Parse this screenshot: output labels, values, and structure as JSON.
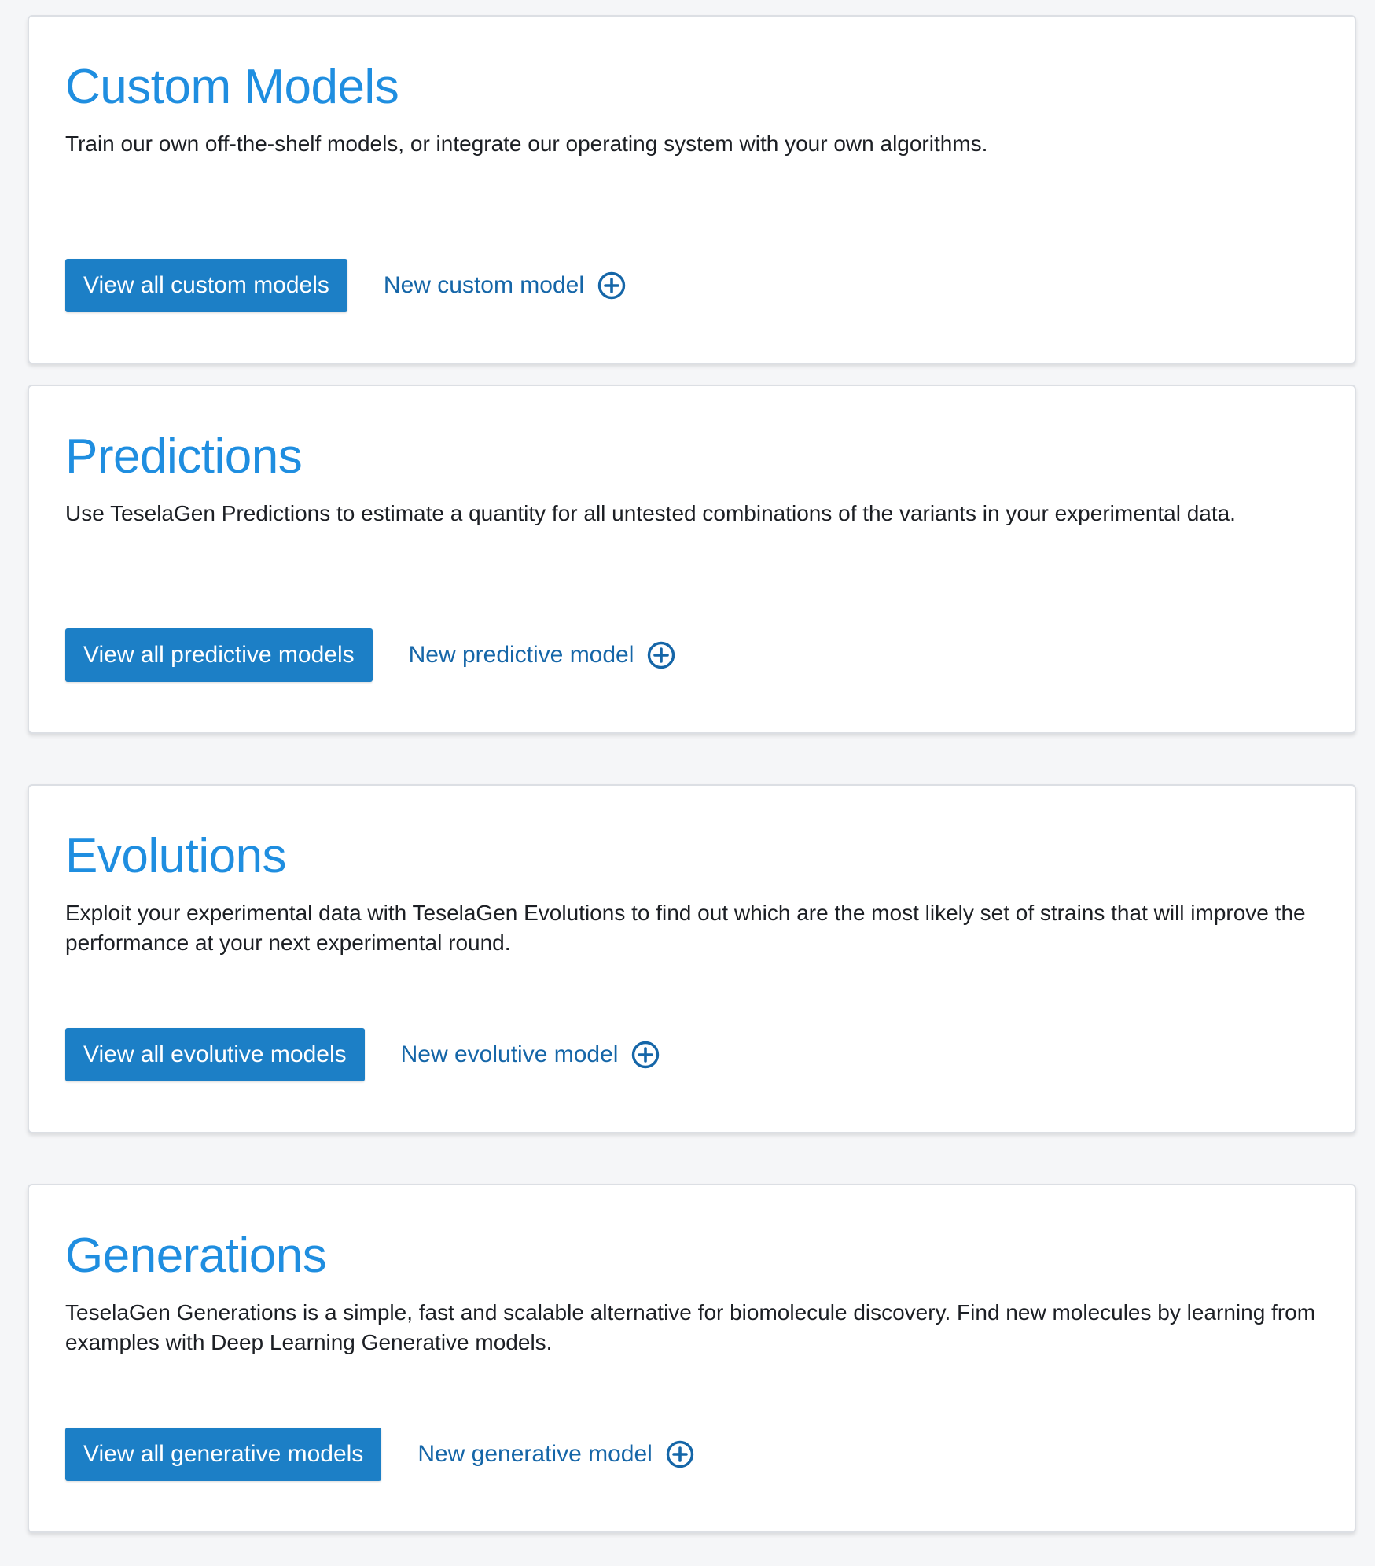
{
  "colors": {
    "title": "#1f8ee0",
    "primary_button": "#1c7fc6",
    "link": "#1566a8",
    "text": "#1c1f24",
    "background": "#f5f6f8"
  },
  "cards": [
    {
      "title": "Custom Models",
      "description": "Train our own off-the-shelf models, or integrate our operating system with your own algorithms.",
      "view_button": "View all custom models",
      "new_link": "New custom model",
      "new_icon": "plus-circle-icon"
    },
    {
      "title": "Predictions",
      "description": "Use TeselaGen Predictions to estimate a quantity for all untested combinations of the variants in your experimental data.",
      "view_button": "View all predictive models",
      "new_link": "New predictive model",
      "new_icon": "plus-circle-icon"
    },
    {
      "title": "Evolutions",
      "description": "Exploit your experimental data with TeselaGen Evolutions to find out which are the most likely set of strains that will improve the performance at your next experimental round.",
      "view_button": "View all evolutive models",
      "new_link": "New evolutive model",
      "new_icon": "plus-circle-icon"
    },
    {
      "title": "Generations",
      "description": "TeselaGen Generations is a simple, fast and scalable alternative for biomolecule discovery. Find new molecules by learning from examples with Deep Learning Generative models.",
      "view_button": "View all generative models",
      "new_link": "New generative model",
      "new_icon": "plus-circle-icon"
    }
  ]
}
